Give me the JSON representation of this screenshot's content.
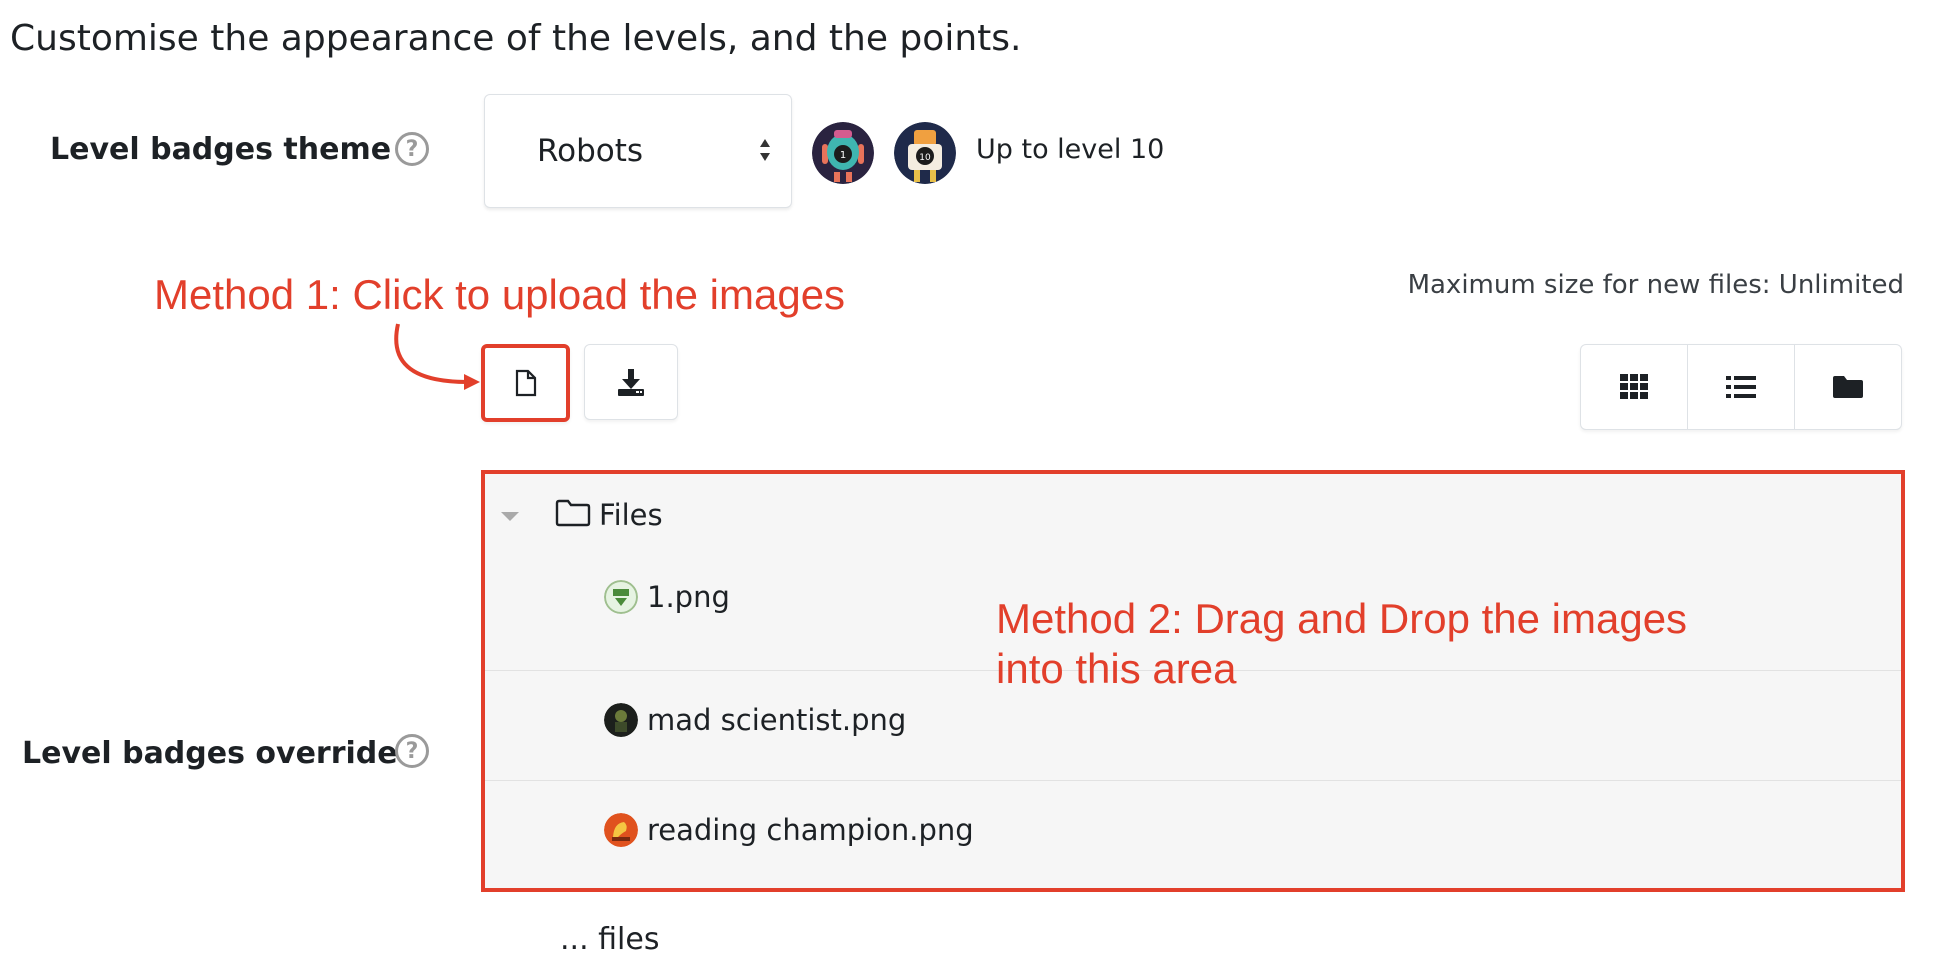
{
  "intro_text": "Customise the appearance of the levels, and the points.",
  "theme_field": {
    "label": "Level badges theme",
    "help_icon": "question-circle-icon",
    "selected": "Robots",
    "preview_note": "Up to level 10",
    "preview_badges": [
      "robot-level-1-badge",
      "robot-level-10-badge"
    ]
  },
  "annotations": {
    "method1": "Method 1: Click to upload the images",
    "method2_line1": "Method 2: Drag and Drop the images",
    "method2_line2": "into this area",
    "accent_color": "#e23f2b"
  },
  "filepicker": {
    "max_size": "Maximum size for new files: Unlimited",
    "add_file_icon": "file-icon",
    "download_icon": "download-icon",
    "view_icons": [
      "grid-view-icon",
      "list-view-icon",
      "folder-view-icon"
    ]
  },
  "override_field": {
    "label": "Level badges override",
    "help_icon": "question-circle-icon",
    "folder_name": "Files",
    "files": [
      {
        "name": "1.png"
      },
      {
        "name": "mad scientist.png"
      },
      {
        "name": "reading champion.png"
      }
    ]
  },
  "cutoff_text": "... files"
}
